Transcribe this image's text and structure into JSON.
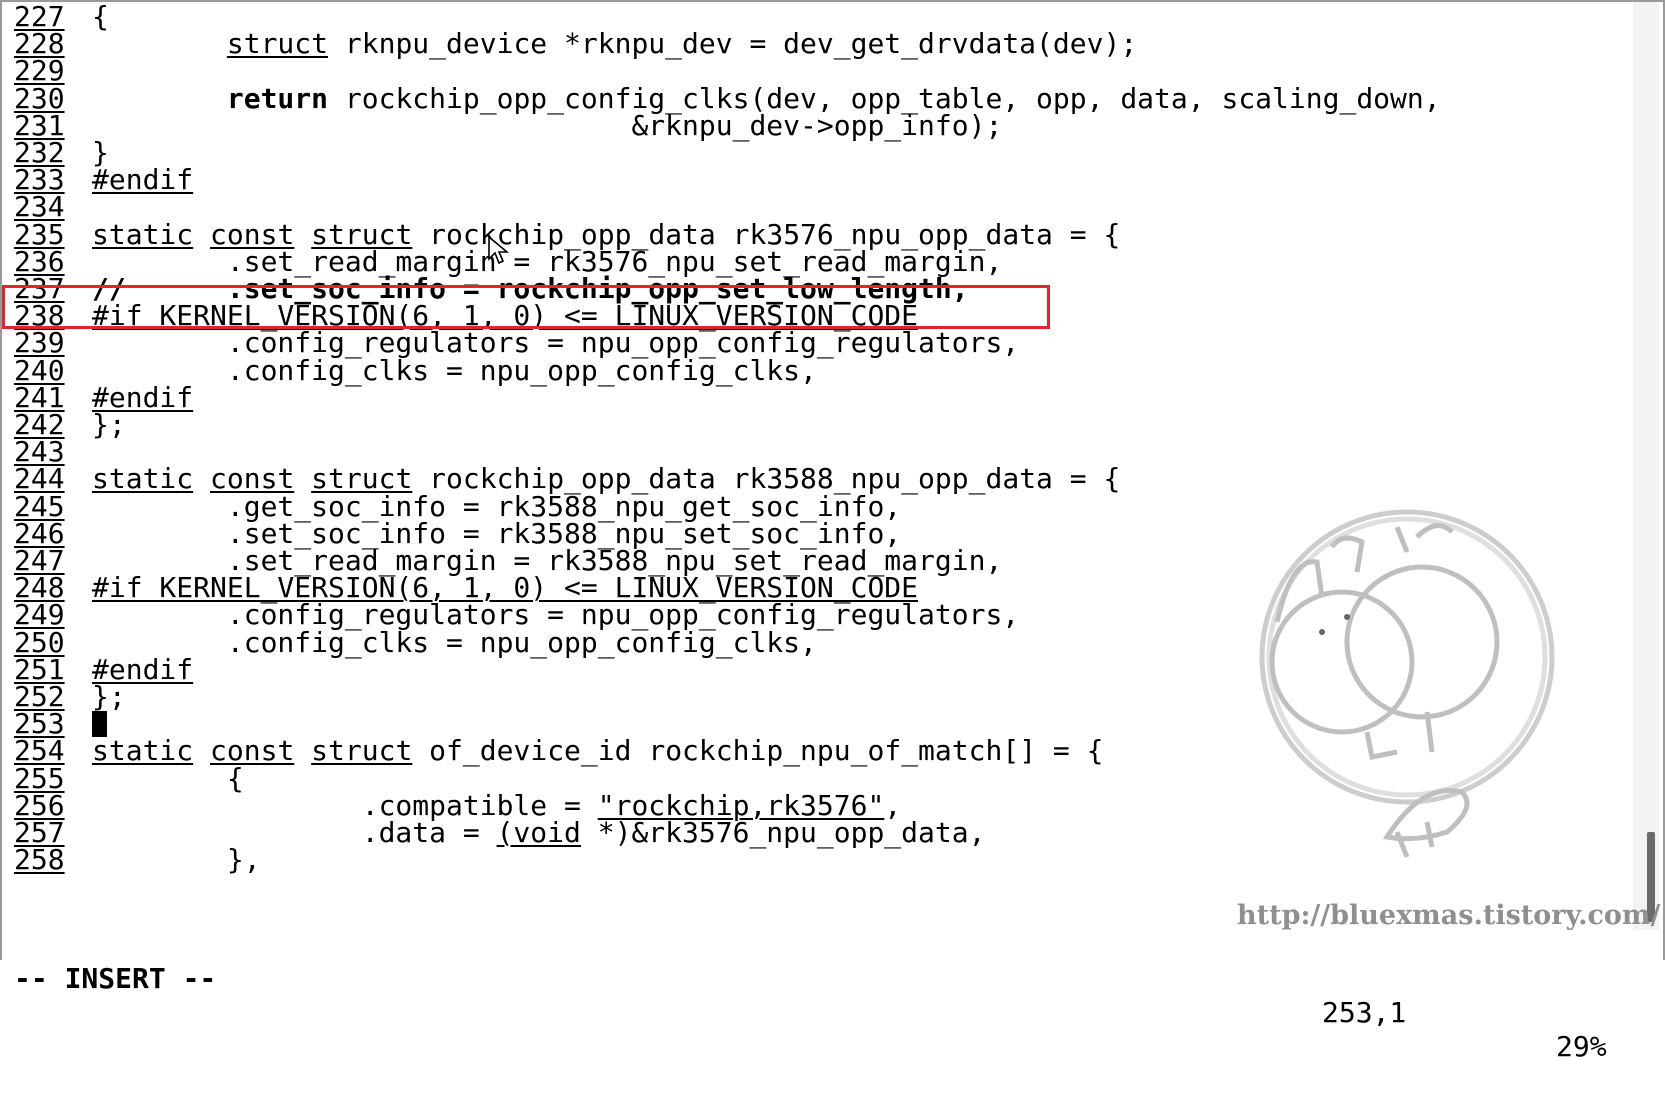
{
  "editor": {
    "lines": [
      {
        "n": "227",
        "segs": [
          {
            "t": "{"
          }
        ]
      },
      {
        "n": "228",
        "segs": [
          {
            "t": "        "
          },
          {
            "t": "struct",
            "u": true
          },
          {
            "t": " rknpu_device *rknpu_dev = dev_get_drvdata(dev);"
          }
        ]
      },
      {
        "n": "229",
        "segs": []
      },
      {
        "n": "230",
        "segs": [
          {
            "t": "        "
          },
          {
            "t": "return",
            "b": true
          },
          {
            "t": " rockchip_opp_config_clks(dev, opp_table, opp, data, scaling_down,"
          }
        ]
      },
      {
        "n": "231",
        "segs": [
          {
            "t": "                                &rknpu_dev->opp_info);"
          }
        ]
      },
      {
        "n": "232",
        "segs": [
          {
            "t": "}"
          }
        ]
      },
      {
        "n": "233",
        "segs": [
          {
            "t": "#endif",
            "u": true
          }
        ]
      },
      {
        "n": "234",
        "segs": []
      },
      {
        "n": "235",
        "segs": [
          {
            "t": "static",
            "u": true
          },
          {
            "t": " "
          },
          {
            "t": "const",
            "u": true
          },
          {
            "t": " "
          },
          {
            "t": "struct",
            "u": true
          },
          {
            "t": " rockchip_opp_data rk3576_npu_opp_data = {"
          }
        ]
      },
      {
        "n": "236",
        "segs": [
          {
            "t": "        .set_read_margin = rk3576_npu_set_read_margin,"
          }
        ]
      },
      {
        "n": "237",
        "segs": [
          {
            "t": "//      .set_soc_info = rockchip_opp_set_low_length,",
            "b": true
          }
        ]
      },
      {
        "n": "238",
        "segs": [
          {
            "t": "#if KERNEL_VERSION(6, 1, 0) <= LINUX_VERSION_CODE",
            "u": true
          }
        ]
      },
      {
        "n": "239",
        "segs": [
          {
            "t": "        .config_regulators = npu_opp_config_regulators,"
          }
        ]
      },
      {
        "n": "240",
        "segs": [
          {
            "t": "        .config_clks = npu_opp_config_clks,"
          }
        ]
      },
      {
        "n": "241",
        "segs": [
          {
            "t": "#endif",
            "u": true
          }
        ]
      },
      {
        "n": "242",
        "segs": [
          {
            "t": "};"
          }
        ]
      },
      {
        "n": "243",
        "segs": []
      },
      {
        "n": "244",
        "segs": [
          {
            "t": "static",
            "u": true
          },
          {
            "t": " "
          },
          {
            "t": "const",
            "u": true
          },
          {
            "t": " "
          },
          {
            "t": "struct",
            "u": true
          },
          {
            "t": " rockchip_opp_data rk3588_npu_opp_data = {"
          }
        ]
      },
      {
        "n": "245",
        "segs": [
          {
            "t": "        .get_soc_info = rk3588_npu_get_soc_info,"
          }
        ]
      },
      {
        "n": "246",
        "segs": [
          {
            "t": "        .set_soc_info = rk3588_npu_set_soc_info,"
          }
        ]
      },
      {
        "n": "247",
        "segs": [
          {
            "t": "        .set_read_margin = rk3588_npu_set_read_margin,"
          }
        ]
      },
      {
        "n": "248",
        "segs": [
          {
            "t": "#if KERNEL_VERSION(6, 1, 0) <= LINUX_VERSION_CODE",
            "u": true
          }
        ]
      },
      {
        "n": "249",
        "segs": [
          {
            "t": "        .config_regulators = npu_opp_config_regulators,"
          }
        ]
      },
      {
        "n": "250",
        "segs": [
          {
            "t": "        .config_clks = npu_opp_config_clks,"
          }
        ]
      },
      {
        "n": "251",
        "segs": [
          {
            "t": "#endif",
            "u": true
          }
        ]
      },
      {
        "n": "252",
        "segs": [
          {
            "t": "};"
          }
        ]
      },
      {
        "n": "253",
        "segs": [],
        "cursor": true
      },
      {
        "n": "254",
        "segs": [
          {
            "t": "static",
            "u": true
          },
          {
            "t": " "
          },
          {
            "t": "const",
            "u": true
          },
          {
            "t": " "
          },
          {
            "t": "struct",
            "u": true
          },
          {
            "t": " of_device_id rockchip_npu_of_match[] = {"
          }
        ]
      },
      {
        "n": "255",
        "segs": [
          {
            "t": "        {"
          }
        ]
      },
      {
        "n": "256",
        "segs": [
          {
            "t": "                .compatible = "
          },
          {
            "t": "\"rockchip,rk3576\"",
            "u": true
          },
          {
            "t": ","
          }
        ]
      },
      {
        "n": "257",
        "segs": [
          {
            "t": "                .data = "
          },
          {
            "t": "(void",
            "u": true
          },
          {
            "t": " *)&rk3576_npu_opp_data,"
          }
        ]
      },
      {
        "n": "258",
        "segs": [
          {
            "t": "        },"
          }
        ]
      }
    ],
    "highlighted_line": "237"
  },
  "status": {
    "mode": "-- INSERT --",
    "position": "253,1",
    "percent": "29%"
  },
  "watermark": {
    "url": "http://bluexmas.tistory.com/",
    "logo_icon": "circular-character-logo-icon"
  },
  "icons": {
    "mouse": "mouse-pointer-icon"
  }
}
